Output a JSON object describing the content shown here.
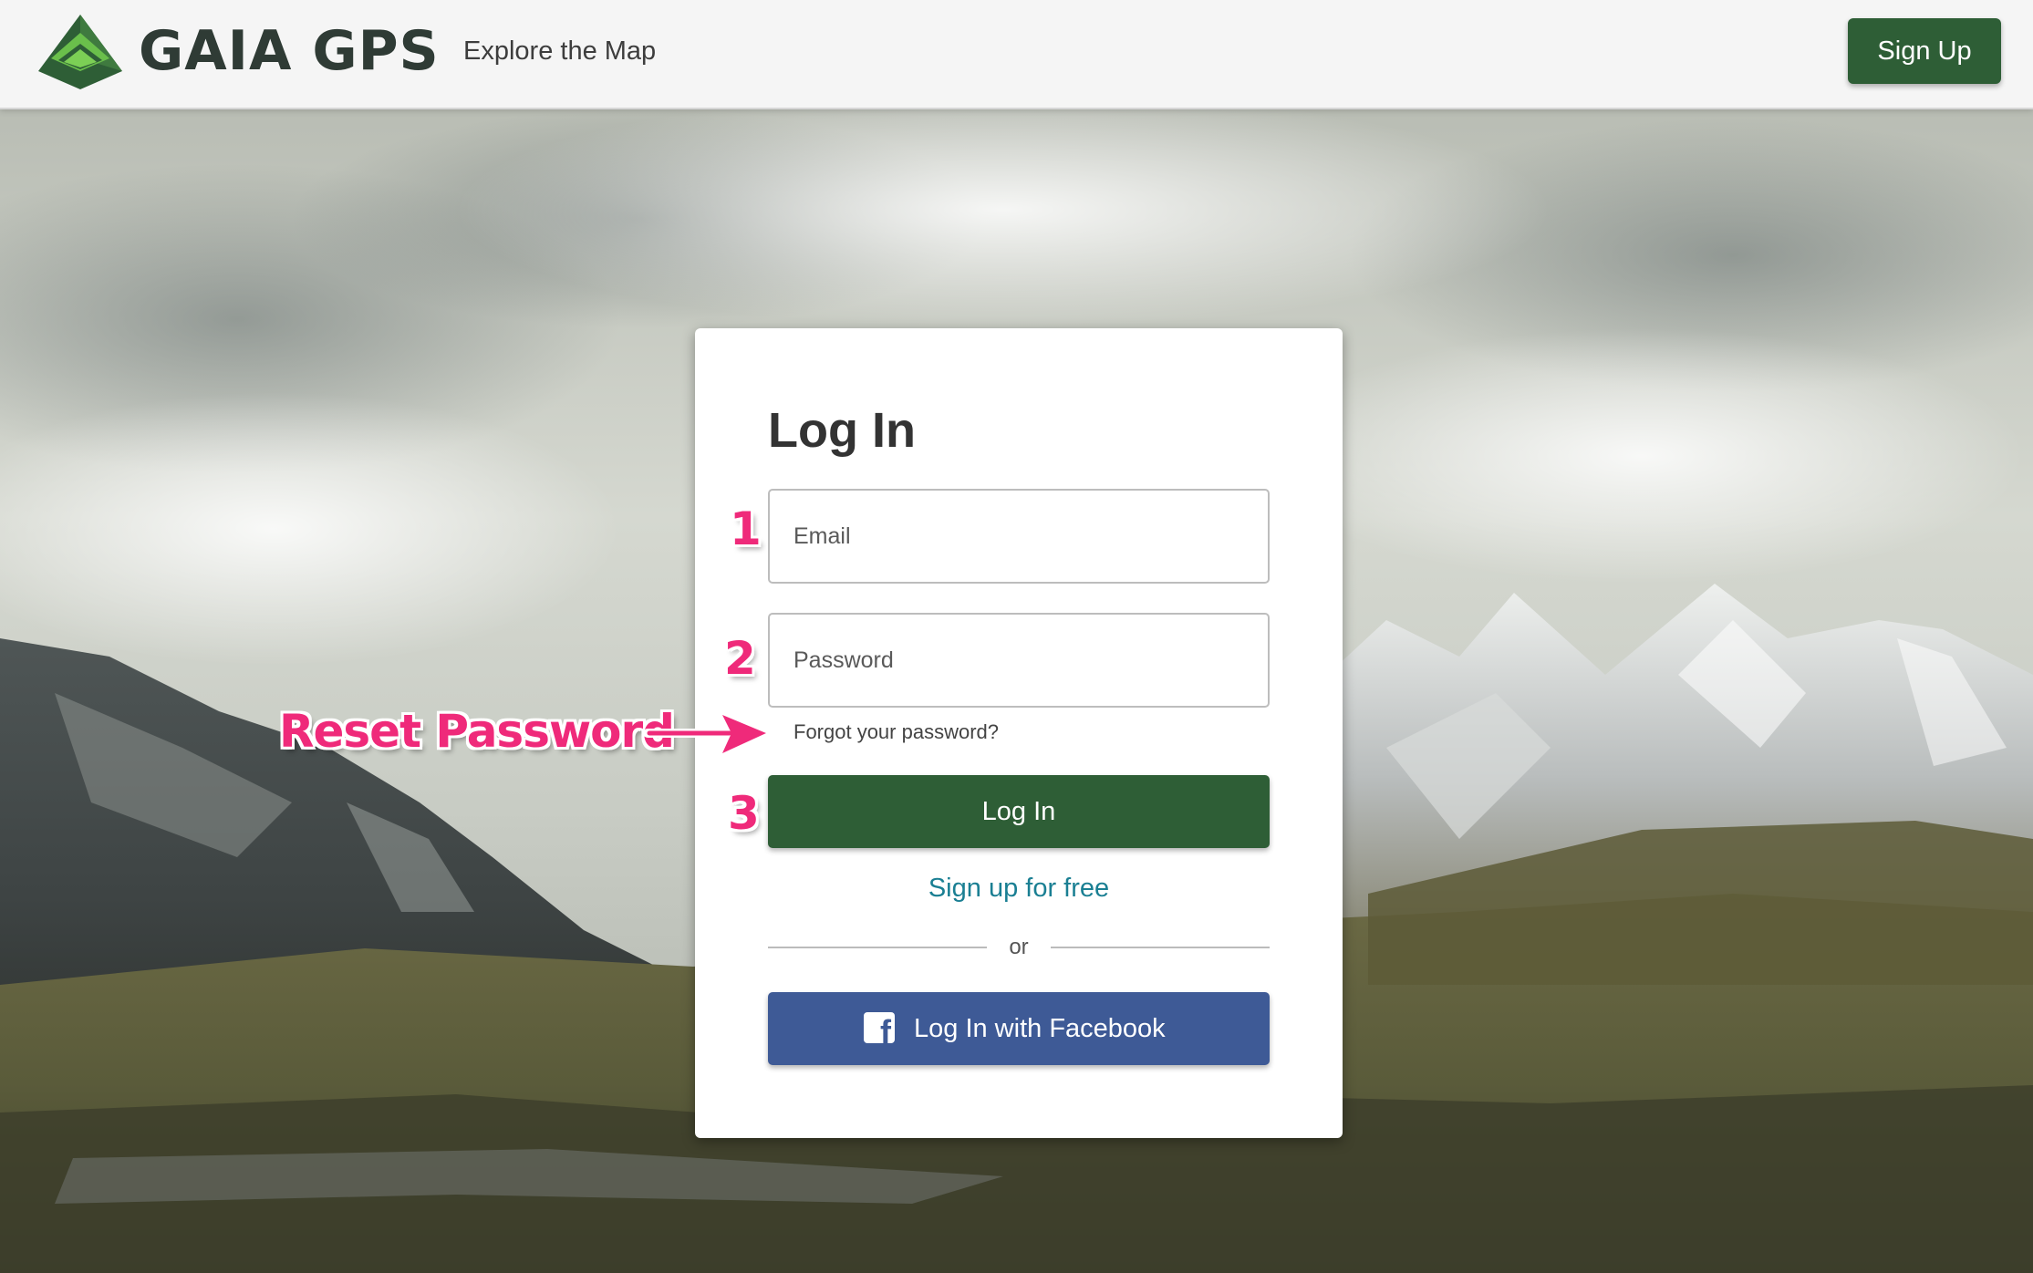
{
  "header": {
    "brand": "GAIA GPS",
    "nav_link": "Explore the Map",
    "signup_label": "Sign Up"
  },
  "login": {
    "title": "Log In",
    "email_placeholder": "Email",
    "password_placeholder": "Password",
    "forgot_label": "Forgot your password?",
    "login_label": "Log In",
    "signup_free_label": "Sign up for free",
    "or_label": "or",
    "facebook_label": "Log In with Facebook"
  },
  "annotations": {
    "step1": "1",
    "step2": "2",
    "step3": "3",
    "reset_callout": "Reset Password",
    "color": "#ef2a7a"
  },
  "colors": {
    "primary_green": "#2e5e36",
    "link_teal": "#1a7f93",
    "facebook_blue": "#3e5a96"
  },
  "icons": {
    "logo": "gaia-mountain-logo",
    "facebook": "facebook-icon",
    "arrow": "arrow-right-icon"
  }
}
